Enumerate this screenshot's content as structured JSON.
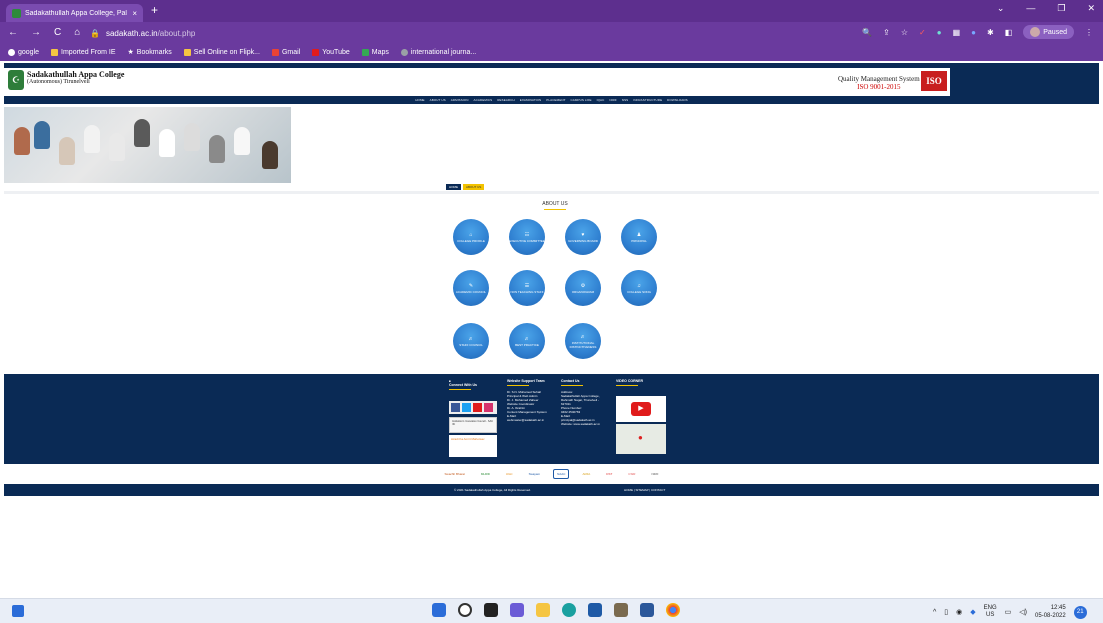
{
  "browser": {
    "tab_title": "Sadakathullah Appa College, Pal",
    "tab_close": "×",
    "new_tab": "+",
    "url_host": "sadakath.ac.in",
    "url_path": "/about.php",
    "paused_label": "Paused",
    "window_controls": [
      "⌄",
      "—",
      "❐",
      "✕"
    ]
  },
  "bookmarks": [
    {
      "label": "google",
      "color": "#ffffff"
    },
    {
      "label": "Imported From IE",
      "color": "#f5c542"
    },
    {
      "label": "Bookmarks",
      "color": "#ffffff"
    },
    {
      "label": "Sell Online on Flipk...",
      "color": "#f5c542"
    },
    {
      "label": "Gmail",
      "color": "#e94335"
    },
    {
      "label": "YouTube",
      "color": "#e01b1b"
    },
    {
      "label": "Maps",
      "color": "#34a853"
    },
    {
      "label": "international journa...",
      "color": "#9aa0a6"
    }
  ],
  "site": {
    "college_name": "Sadakathullah Appa College",
    "college_sub": "(Autonomous) Tirunelveli",
    "qms_line1": "Quality Management System",
    "qms_line2": "ISO 9001-2015",
    "iso_badge": "ISO",
    "menu": [
      "HOME",
      "ABOUT US",
      "ADMISSION",
      "ACADEMICS",
      "RESEARCH",
      "EXAMINATION",
      "PLACEMENT",
      "CAMPUS LIFE",
      "IQAC",
      "NIRF",
      "NSS",
      "INFRASTRUCTURE",
      "DOWNLOADS"
    ],
    "crumb_home": "HOME",
    "crumb_current": "ABOUT US",
    "about_title": "ABOUT US",
    "circles": [
      {
        "label": "COLLEGE PROFILE",
        "icon": "⌂"
      },
      {
        "label": "EXECUTIVE COMMITTEE",
        "icon": "☷"
      },
      {
        "label": "GOVERNING BOARD",
        "icon": "♥"
      },
      {
        "label": "PRINCIPAL",
        "icon": "♟"
      },
      {
        "label": "ACADEMIC COUNCIL",
        "icon": "✎"
      },
      {
        "label": "NON TEACHING STAFF",
        "icon": "☰"
      },
      {
        "label": "ORGANOGRAM",
        "icon": "⚙"
      },
      {
        "label": "COLLEGE SONG",
        "icon": "♫"
      },
      {
        "label": "STAFF COUNCIL",
        "icon": "♬"
      },
      {
        "label": "BEST PRACTICE",
        "icon": "♬"
      },
      {
        "label": "INSTITUTIONAL DISTINCTIVENESS",
        "icon": "♬"
      }
    ],
    "footer": {
      "connect_title": "Connect With Us",
      "support_title": "Website Support Team",
      "support_lines": [
        "Dr. S.N. Mohamed Suhail",
        "Principal & Web Admin",
        "Dr. J. Mohamed Zaheer",
        "Website Coordinator",
        "Dr. A. Ibrahim",
        "Content Management System",
        "E-Mail:",
        "webmaster@sadakath.ac.in"
      ],
      "contact_title": "Contact Us",
      "contact_lines": [
        "Address:",
        "Sadakathullah Appa College, Rahmath Nagar, Tirunelveli - 627011",
        "Phone Number:",
        "0462 2540763",
        "E-Mail:",
        "principal@sadakath.ac.in",
        "Website: www.sadakath.ac.in"
      ],
      "video_title": "VIDEO CORNER",
      "badge1": "Institution's Innovation Council - SAC IIC",
      "badge2": "Azadi Ka Amrit Mahotsav"
    },
    "partner_logos": [
      "Swachh Bharat",
      "MHRD",
      "UGC",
      "Swayam",
      "NAAC",
      "ARIIA",
      "DST",
      "CSIR",
      "NIRF"
    ],
    "copyright": "© 2021 Sadakathullah Appa College, All Rights Reserved.",
    "copyright_links": "HOME  |  SITEMAP  |  CONTACT"
  },
  "taskbar": {
    "lang_top": "ENG",
    "lang_bottom": "US",
    "time": "12:45",
    "date": "05-08-2022",
    "notifications": "21"
  }
}
